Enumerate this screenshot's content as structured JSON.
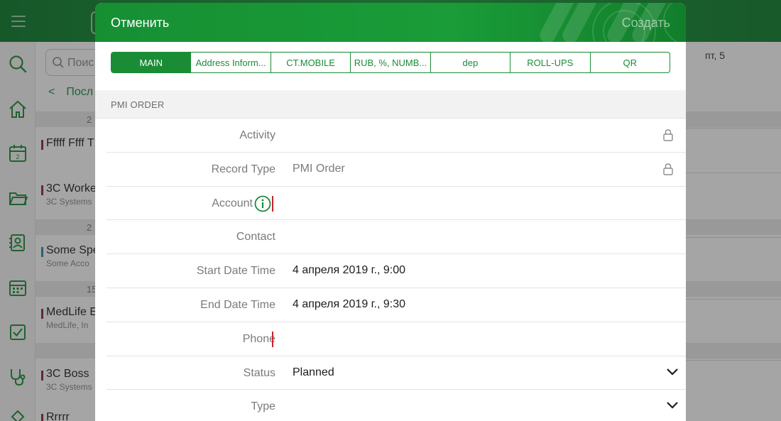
{
  "background": {
    "search_placeholder": "Поис",
    "back_label": "Посл",
    "date_label": "пт,  5",
    "groups": [
      "2",
      "2",
      "15"
    ],
    "items": [
      {
        "title": "Fffff Ffff T",
        "subtitle": ""
      },
      {
        "title": "3C Worke",
        "subtitle": "3C Systems"
      },
      {
        "title": "Some Spe",
        "subtitle": "Some Acco"
      },
      {
        "title": "MedLife E",
        "subtitle": "MedLife, In"
      },
      {
        "title": "3C Boss",
        "subtitle": "3C Systems"
      },
      {
        "title": "Rrrrr",
        "subtitle": ""
      }
    ]
  },
  "modal": {
    "cancel_label": "Отменить",
    "create_label": "Создать",
    "tabs": [
      "MAIN",
      "Address Inform...",
      "CT.MOBILE",
      "RUB, %, NUMB...",
      "dep",
      "ROLL-UPS",
      "QR"
    ],
    "active_tab": 0,
    "section_title": "PMI ORDER",
    "fields": [
      {
        "label": "Activity",
        "value": "",
        "locked": true
      },
      {
        "label": "Record Type",
        "value": "PMI Order",
        "locked": true
      },
      {
        "label": "Account",
        "value": "",
        "required": true,
        "info": true
      },
      {
        "label": "Contact",
        "value": ""
      },
      {
        "label": "Start Date Time",
        "value": "4 апреля 2019 г., 9:00"
      },
      {
        "label": "End Date Time",
        "value": "4 апреля 2019 г., 9:30"
      },
      {
        "label": "Phone",
        "value": "",
        "required": true
      },
      {
        "label": "Status",
        "value": "Planned",
        "dropdown": true
      },
      {
        "label": "Type",
        "value": "",
        "dropdown": true
      }
    ]
  },
  "colors": {
    "brand_green": "#1a8c36",
    "required_red": "#cc1f2f"
  }
}
